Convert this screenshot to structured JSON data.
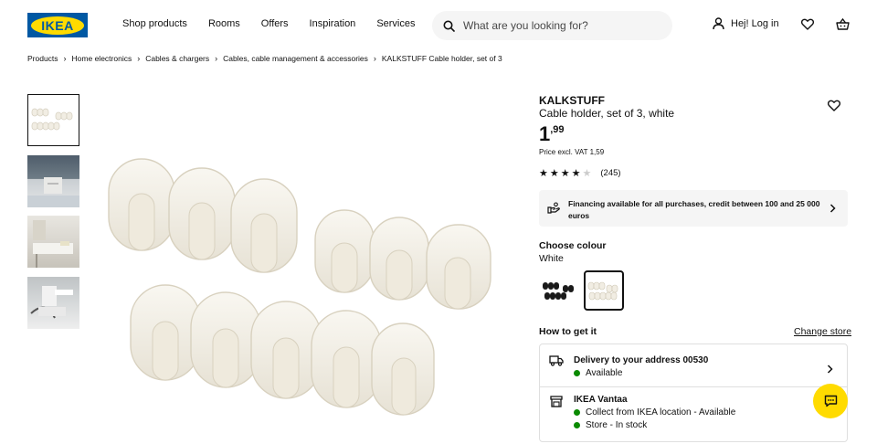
{
  "header": {
    "logo_text": "IKEA",
    "nav": [
      "Shop products",
      "Rooms",
      "Offers",
      "Inspiration",
      "Services"
    ],
    "search_placeholder": "What are you looking for?",
    "login_label": "Hej! Log in"
  },
  "breadcrumb": [
    "Products",
    "Home electronics",
    "Cables & chargers",
    "Cables, cable management & accessories",
    "KALKSTUFF Cable holder, set of 3"
  ],
  "product": {
    "name": "KALKSTUFF",
    "description": "Cable holder, set of 3, white",
    "price_int": "1",
    "price_dec": ",99",
    "vat_text": "Price excl. VAT 1,59",
    "rating": 4,
    "rating_max": 5,
    "review_count": "(245)",
    "financing_text": "Financing available for all purchases, credit between 100 and 25 000 euros",
    "choose_colour_label": "Choose colour",
    "colour_name": "White"
  },
  "delivery": {
    "how_label": "How to get it",
    "change_store": "Change store",
    "delivery_title": "Delivery to your address 00530",
    "delivery_status": "Available",
    "store_title": "IKEA Vantaa",
    "store_collect": "Collect from IKEA location - Available",
    "store_stock": "Store - In stock"
  },
  "colors": {
    "ikea_blue": "#0058a3",
    "ikea_yellow": "#ffdb00",
    "available_green": "#0a8a00"
  }
}
